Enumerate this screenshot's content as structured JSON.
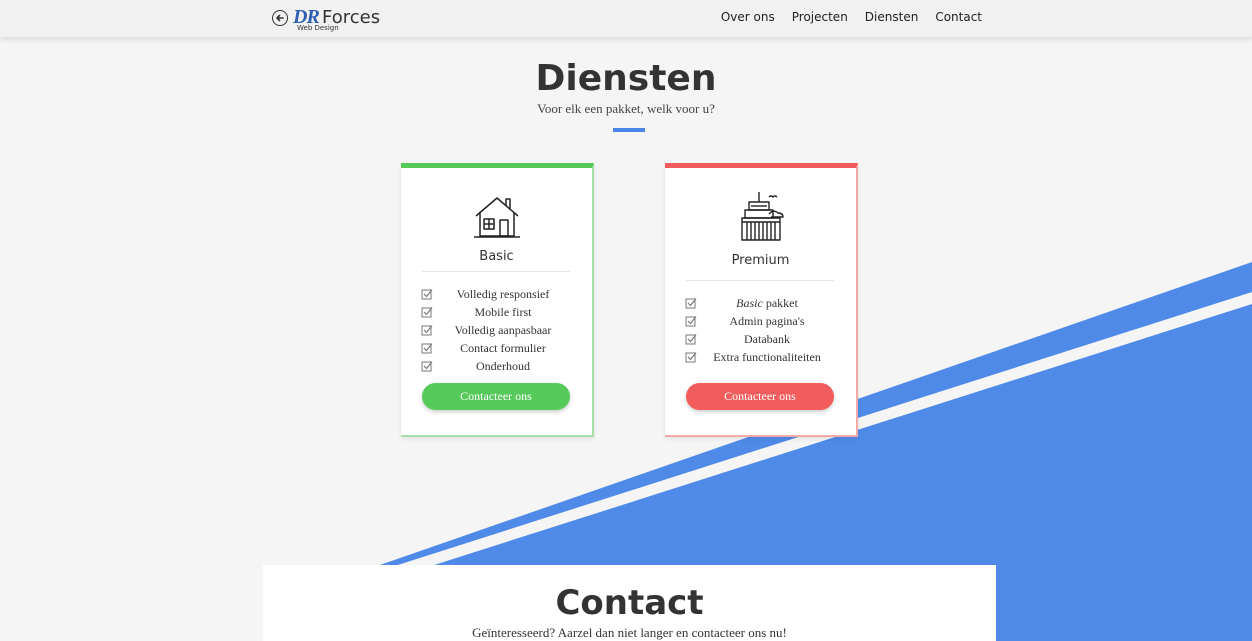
{
  "nav": {
    "back_icon": "arrow-left-circle-icon",
    "logo_mark": "DR",
    "logo_word": "Forces",
    "logo_sub": "Web Design",
    "links": [
      "Over ons",
      "Projecten",
      "Diensten",
      "Contact"
    ]
  },
  "diensten": {
    "title": "Diensten",
    "subtitle": "Voor elk een pakket, welk voor u?",
    "accent": "#4a86e8"
  },
  "packages": [
    {
      "name": "Basic",
      "icon": "house-icon",
      "color": "#55c95a",
      "features": [
        "Volledig responsief",
        "Mobile first",
        "Volledig aanpasbaar",
        "Contact formulier",
        "Onderhoud"
      ],
      "button": "Contacteer ons"
    },
    {
      "name": "Premium",
      "icon": "city-buildings-icon",
      "color": "#f25c5c",
      "features_first_em": "Basic",
      "features_first_rest": " pakket",
      "features": [
        "Admin pagina's",
        "Databank",
        "Extra functionaliteiten"
      ],
      "button": "Contacteer ons"
    }
  ],
  "contact": {
    "title": "Contact",
    "subtitle": "Geïnteresseerd? Aarzel dan niet langer en contacteer ons nu!"
  },
  "colors": {
    "background": "#f5f5f5",
    "blue_shape": "#4f8ae8"
  }
}
